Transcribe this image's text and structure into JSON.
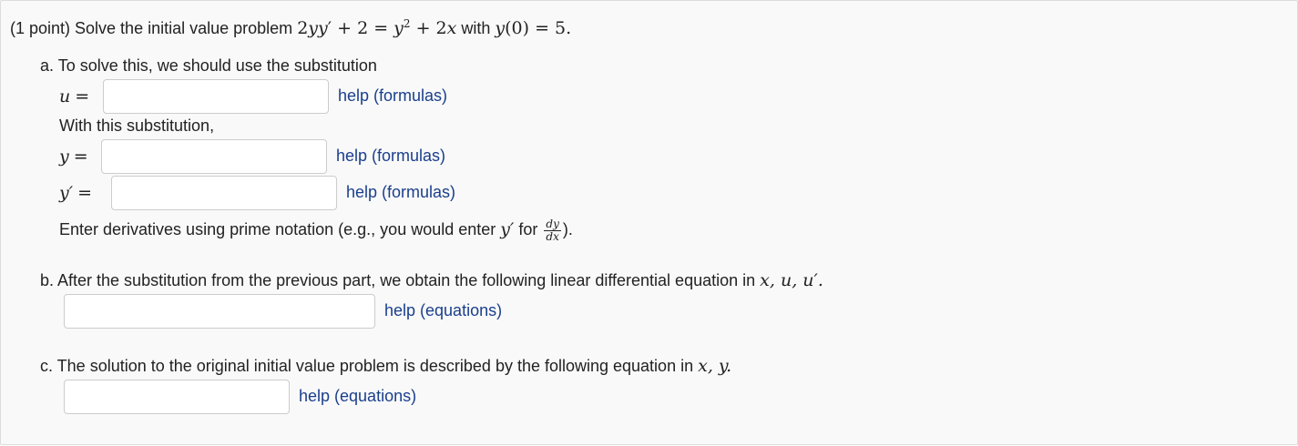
{
  "problem": {
    "points_label": "(1 point) Solve the initial value problem",
    "equation_parts": [
      "2",
      "yy",
      "′",
      " + 2 = ",
      "y",
      "2",
      " + 2",
      "x"
    ],
    "with_text": "with",
    "initial_condition": [
      "y",
      "(0) = 5."
    ]
  },
  "part_a": {
    "intro": "a. To solve this, we should use the substitution",
    "u_var": "u",
    "equals": "=",
    "with_sub": "With this substitution,",
    "y_var": "y",
    "yprime_var": "y′",
    "hint_prefix": "Enter derivatives using prime notation (e.g., you would enter",
    "hint_for": "for",
    "frac_num": "dy",
    "frac_den": "dx",
    "hint_suffix": ")."
  },
  "part_b": {
    "text": "b. After the substitution from the previous part, we obtain the following linear differential equation in",
    "vars": "x, u, u′."
  },
  "part_c": {
    "text": "c. The solution to the original initial value problem is described by the following equation in",
    "vars": "x, y."
  },
  "help": {
    "formulas": "help (formulas)",
    "equations": "help (equations)"
  },
  "inputs": {
    "u_value": "",
    "y_value": "",
    "yprime_value": "",
    "linear_eq_value": "",
    "solution_value": ""
  }
}
